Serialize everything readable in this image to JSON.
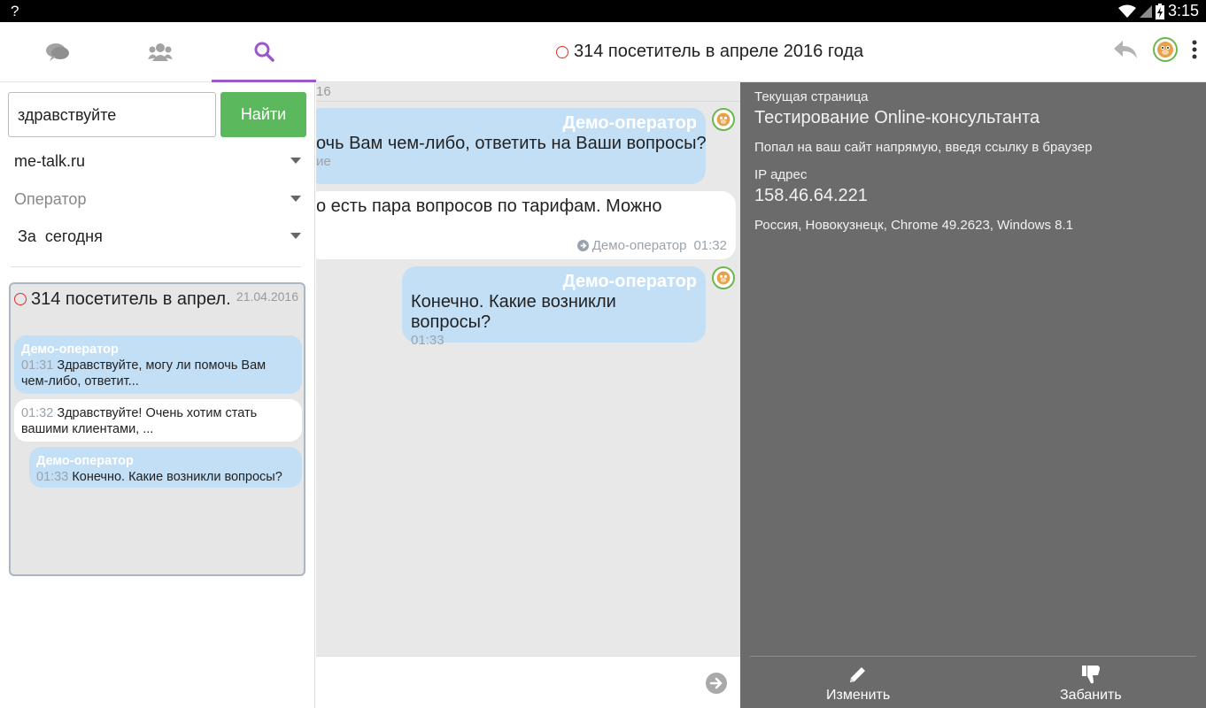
{
  "status_bar": {
    "left_symbol": "?",
    "time": "3:15"
  },
  "tabs": [
    {
      "name": "chats",
      "icon": "chat-bubbles-icon"
    },
    {
      "name": "visitors",
      "icon": "users-icon"
    },
    {
      "name": "search",
      "icon": "search-icon",
      "active": true
    }
  ],
  "header": {
    "title": "314 посетитель в апреле 2016 года"
  },
  "search": {
    "query": "здравствуйте",
    "button_label": "Найти",
    "site_filter": "me-talk.ru",
    "operator_filter_placeholder": "Оператор",
    "period_filter": "За  сегодня"
  },
  "result": {
    "title": "314 посетитель в апрел...",
    "date": "21.04.2016",
    "snippets": [
      {
        "who": "Демо-оператор",
        "time": "01:31",
        "text": "Здравствуйте, могу ли помочь Вам чем-либо, ответит..."
      },
      {
        "who": "",
        "time": "01:32",
        "text": "Здравствуйте! Очень хотим стать вашими клиентами, ..."
      },
      {
        "who": "Демо-оператор",
        "time": "01:33",
        "text": "Конечно. Какие возникли вопросы?"
      }
    ]
  },
  "chat": {
    "date_fragment": "16",
    "messages": [
      {
        "who": "Демо-оператор",
        "text": "очь Вам чем-либо, ответить на Ваши вопросы?",
        "time_fragment": "ие"
      },
      {
        "text": "о есть пара вопросов по тарифам. Можно",
        "meta_who": "Демо-оператор",
        "meta_time": "01:32"
      },
      {
        "who": "Демо-оператор",
        "text": "Конечно. Какие возникли вопросы?",
        "time": "01:33"
      }
    ]
  },
  "info": {
    "current_page_label": "Текущая страница",
    "current_page_value": "Тестирование Online-консультанта",
    "referrer_text": "Попал на ваш сайт напрямую, введя ссылку в браузер",
    "ip_label": "IP адрес",
    "ip_value": "158.46.64.221",
    "client_text": "Россия, Новокузнецк, Chrome 49.2623, Windows 8.1",
    "edit_label": "Изменить",
    "ban_label": "Забанить"
  },
  "colors": {
    "accent": "#9b59c8",
    "search_button": "#5cb85c",
    "operator_bubble": "#c3dff6",
    "info_panel": "#6b6b6b",
    "offline_ring": "#e0312c"
  }
}
